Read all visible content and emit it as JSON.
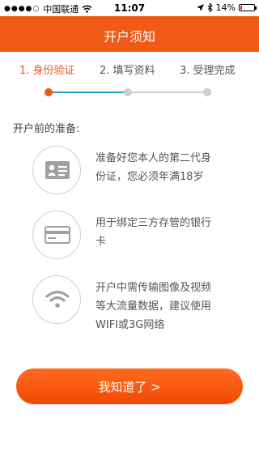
{
  "status_bar": {
    "carrier": "中国联通",
    "time": "11:07",
    "battery_text": "14%",
    "battery_level": 0.14
  },
  "header": {
    "title": "开户须知"
  },
  "steps": [
    {
      "label": "1. 身份验证",
      "active": true
    },
    {
      "label": "2. 填写资料",
      "active": false
    },
    {
      "label": "3. 受理完成",
      "active": false
    }
  ],
  "section_title": "开户前的准备:",
  "items": [
    {
      "icon": "id-card-icon",
      "lines": [
        "准备好您本人的第二代身",
        "份证，您必须年满18岁"
      ]
    },
    {
      "icon": "bank-card-icon",
      "lines": [
        "用于绑定三方存管的银行",
        "卡"
      ]
    },
    {
      "icon": "wifi-icon",
      "lines": [
        "开户中需传输图像及视频",
        "等大流量数据，建议使用",
        "WIFI或3G网络"
      ]
    }
  ],
  "confirm_button": {
    "label": "我知道了 >"
  },
  "colors": {
    "accent": "#f05a14",
    "progress_blue": "#2a9fd6",
    "icon_gray": "#a0a0a0"
  }
}
